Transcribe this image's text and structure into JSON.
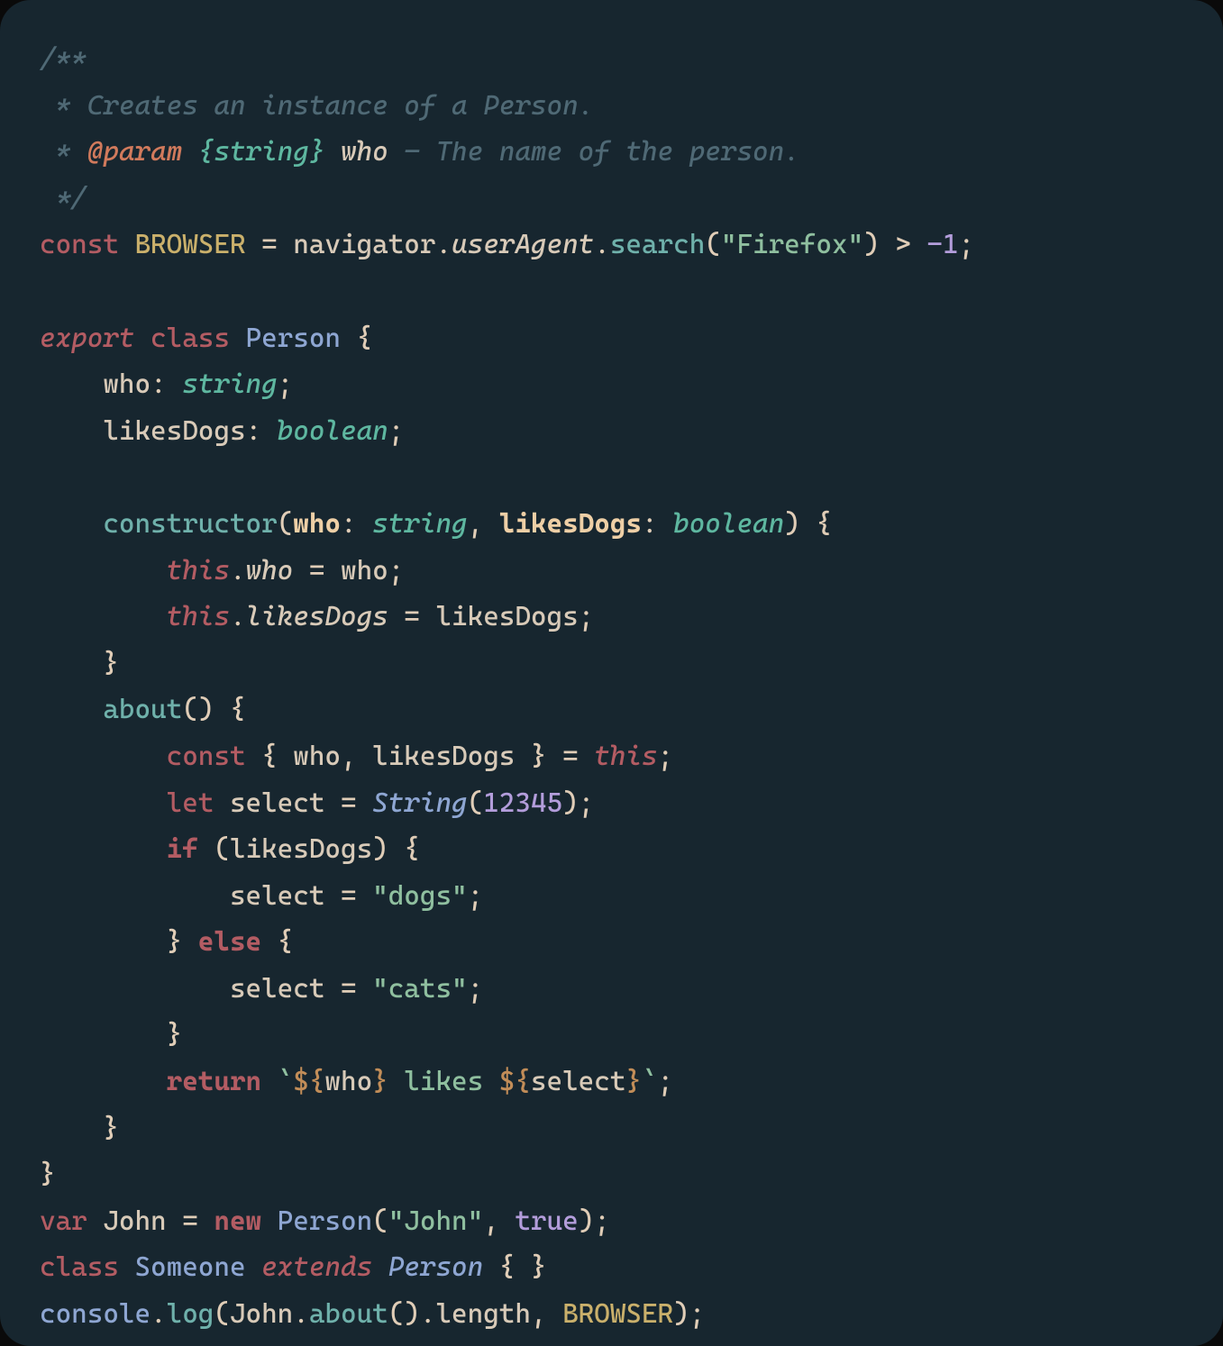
{
  "code": {
    "doc_open": "/**",
    "doc_line1_star": " * ",
    "doc_line1_text": "Creates an instance of a Person.",
    "doc_line2_star": " * ",
    "doc_param_tag": "@param",
    "doc_param_type": "{string}",
    "doc_param_name": "who",
    "doc_param_rest": " – The name of the person.",
    "doc_close": " */",
    "kw_const": "const",
    "id_BROWSER": "BROWSER",
    "eq": " = ",
    "id_navigator": "navigator",
    "dot": ".",
    "prop_userAgent": "userAgent",
    "fn_search": "search",
    "paren_open": "(",
    "paren_close": ")",
    "str_firefox": "\"Firefox\"",
    "gt": " > ",
    "num_neg1": "-1",
    "semi": ";",
    "kw_export": "export",
    "kw_class": "class",
    "cls_Person": "Person",
    "brace_open": " {",
    "brace_close": "}",
    "fld_who": "who",
    "colon": ": ",
    "type_string": "string",
    "fld_likesDogs": "likesDogs",
    "type_boolean": "boolean",
    "fn_constructor": "constructor",
    "param_who": "who",
    "param_likesDogs": "likesDogs",
    "comma": ", ",
    "kw_this": "this",
    "prop_who": "who",
    "prop_likesDogs": "likesDogs",
    "id_who": "who",
    "id_likesDogs": "likesDogs",
    "fn_about": "about",
    "kw_let": "let",
    "id_select": "select",
    "cls_String": "String",
    "num_12345": "12345",
    "kw_if": "if",
    "str_dogs": "\"dogs\"",
    "kw_else": "else",
    "str_cats": "\"cats\"",
    "kw_return": "return",
    "tmpl_tick": "`",
    "interp_open": "${",
    "interp_close": "}",
    "tmpl_likes": " likes ",
    "kw_var": "var",
    "id_John": "John",
    "kw_new": "new",
    "str_John": "\"John\"",
    "bool_true": "true",
    "cls_Someone": "Someone",
    "kw_extends": "extends",
    "empty_braces": "{ }",
    "id_console": "console",
    "fn_log": "log",
    "prop_length": "length"
  }
}
